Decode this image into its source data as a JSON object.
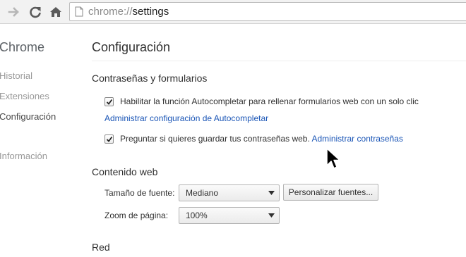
{
  "browser": {
    "back_icon": "arrow-right-icon",
    "reload_icon": "reload-icon",
    "home_icon": "home-icon",
    "url_scheme": "chrome://",
    "url_host": "settings"
  },
  "sidebar": {
    "title": "Chrome",
    "items": [
      {
        "label": "Historial"
      },
      {
        "label": "Extensiones"
      },
      {
        "label": "Configuración",
        "selected": true
      },
      {
        "label": "Información"
      }
    ]
  },
  "main": {
    "title": "Configuración",
    "sections": {
      "passwords": {
        "title": "Contraseñas y formularios",
        "autofill_checkbox": {
          "checked": true,
          "label": "Habilitar la función Autocompletar para rellenar formularios web con un solo clic"
        },
        "autofill_link": "Administrar configuración de Autocompletar",
        "save_passwords_checkbox": {
          "checked": true,
          "label": "Preguntar si quieres guardar tus contraseñas web.",
          "link": "Administrar contraseñas"
        }
      },
      "web_content": {
        "title": "Contenido web",
        "font_size_label": "Tamaño de fuente:",
        "font_size_value": "Mediano",
        "customize_fonts_button": "Personalizar fuentes...",
        "zoom_label": "Zoom de página:",
        "zoom_value": "100%"
      },
      "network": {
        "title": "Red"
      }
    }
  },
  "colors": {
    "link": "#1a55b6",
    "text": "#303030",
    "sidebar_text": "#999999"
  }
}
